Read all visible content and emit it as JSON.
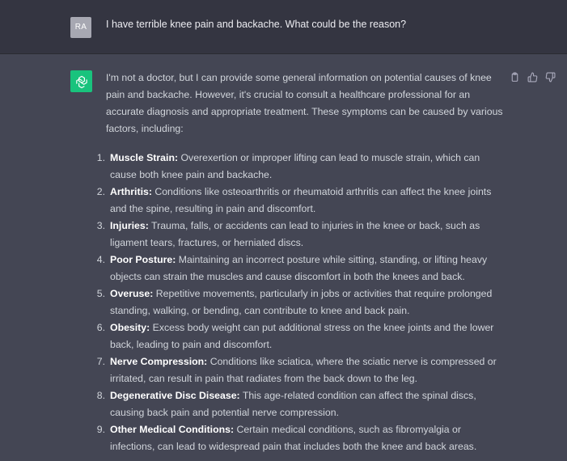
{
  "user_message": {
    "avatar_initials": "RA",
    "text": "I have terrible knee pain and backache. What could be the reason?"
  },
  "assistant_message": {
    "intro": "I'm not a doctor, but I can provide some general information on potential causes of knee pain and backache. However, it's crucial to consult a healthcare professional for an accurate diagnosis and appropriate treatment. These symptoms can be caused by various factors, including:",
    "items": [
      {
        "num": "1.",
        "term": "Muscle Strain:",
        "text": " Overexertion or improper lifting can lead to muscle strain, which can cause both knee pain and backache."
      },
      {
        "num": "2.",
        "term": "Arthritis:",
        "text": " Conditions like osteoarthritis or rheumatoid arthritis can affect the knee joints and the spine, resulting in pain and discomfort."
      },
      {
        "num": "3.",
        "term": "Injuries:",
        "text": " Trauma, falls, or accidents can lead to injuries in the knee or back, such as ligament tears, fractures, or herniated discs."
      },
      {
        "num": "4.",
        "term": "Poor Posture:",
        "text": " Maintaining an incorrect posture while sitting, standing, or lifting heavy objects can strain the muscles and cause discomfort in both the knees and back."
      },
      {
        "num": "5.",
        "term": "Overuse:",
        "text": " Repetitive movements, particularly in jobs or activities that require prolonged standing, walking, or bending, can contribute to knee and back pain."
      },
      {
        "num": "6.",
        "term": "Obesity:",
        "text": " Excess body weight can put additional stress on the knee joints and the lower back, leading to pain and discomfort."
      },
      {
        "num": "7.",
        "term": "Nerve Compression:",
        "text": " Conditions like sciatica, where the sciatic nerve is compressed or irritated, can result in pain that radiates from the back down to the leg."
      },
      {
        "num": "8.",
        "term": "Degenerative Disc Disease:",
        "text": " This age-related condition can affect the spinal discs, causing back pain and potential nerve compression."
      },
      {
        "num": "9.",
        "term": "Other Medical Conditions:",
        "text": " Certain medical conditions, such as fibromyalgia or infections, can lead to widespread pain that includes both the knee and back areas."
      }
    ]
  },
  "icons": {
    "assistant_avatar": "openai-logo-icon",
    "copy": "clipboard-icon",
    "like": "thumbs-up-icon",
    "dislike": "thumbs-down-icon"
  },
  "colors": {
    "user_bg": "#343541",
    "assistant_bg": "#444654",
    "avatar_user": "#a7a8b2",
    "avatar_gpt": "#19c37d",
    "text": "#d1d5db"
  }
}
